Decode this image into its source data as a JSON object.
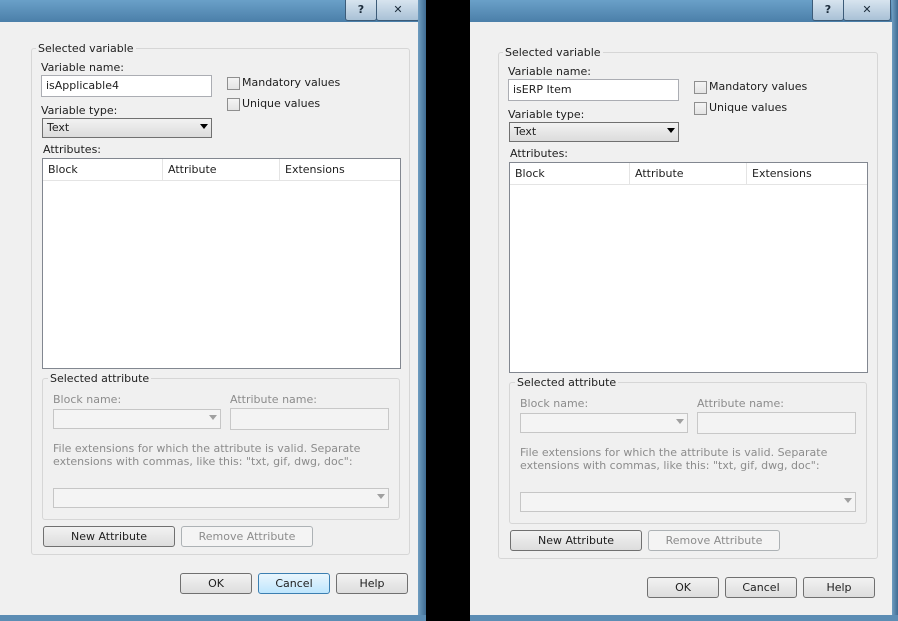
{
  "dialogs": [
    {
      "title_buttons": {
        "help": "?",
        "close": "✕"
      },
      "selected_variable_legend": "Selected variable",
      "variable_name_label": "Variable name:",
      "variable_name_value": "isApplicable4",
      "mandatory_label": "Mandatory values",
      "unique_label": "Unique values",
      "variable_type_label": "Variable type:",
      "variable_type_value": "Text",
      "attributes_label": "Attributes:",
      "columns": [
        "Block",
        "Attribute",
        "Extensions"
      ],
      "selected_attribute_legend": "Selected attribute",
      "block_name_label": "Block name:",
      "attribute_name_label": "Attribute name:",
      "extensions_help": "File extensions for which the attribute is valid. Separate extensions with commas, like this: \"txt, gif, dwg, doc\":",
      "new_attribute": "New Attribute",
      "remove_attribute": "Remove Attribute",
      "ok": "OK",
      "cancel": "Cancel",
      "help": "Help"
    },
    {
      "title_buttons": {
        "help": "?",
        "close": "✕"
      },
      "selected_variable_legend": "Selected variable",
      "variable_name_label": "Variable name:",
      "variable_name_value": "isERP Item",
      "mandatory_label": "Mandatory values",
      "unique_label": "Unique values",
      "variable_type_label": "Variable type:",
      "variable_type_value": "Text",
      "attributes_label": "Attributes:",
      "columns": [
        "Block",
        "Attribute",
        "Extensions"
      ],
      "selected_attribute_legend": "Selected attribute",
      "block_name_label": "Block name:",
      "attribute_name_label": "Attribute name:",
      "extensions_help": "File extensions for which the attribute is valid. Separate extensions with commas, like this: \"txt, gif, dwg, doc\":",
      "new_attribute": "New Attribute",
      "remove_attribute": "Remove Attribute",
      "ok": "OK",
      "cancel": "Cancel",
      "help": "Help"
    }
  ],
  "colors": {
    "cancel_default_accent": "#bee6fd",
    "title_bar": "#5c8db4"
  }
}
